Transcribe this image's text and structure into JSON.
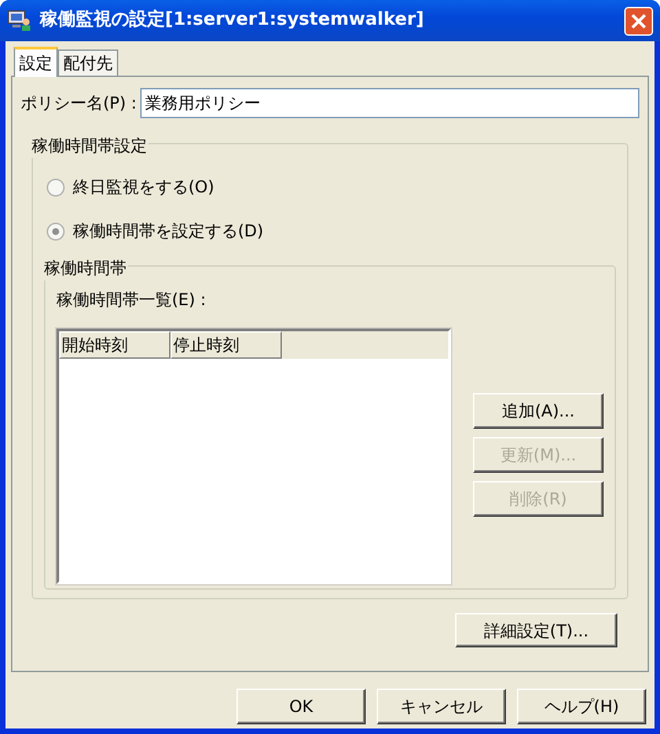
{
  "window": {
    "title": "稼働監視の設定[1:server1:systemwalker]"
  },
  "tabs": [
    {
      "label": "設定",
      "selected": true
    },
    {
      "label": "配付先",
      "selected": false
    }
  ],
  "policy_name": {
    "label": "ポリシー名(P) :",
    "value": "業務用ポリシー"
  },
  "time_settings": {
    "title": "稼働時間帯設定",
    "options": [
      {
        "label": "終日監視をする(O)",
        "selected": false
      },
      {
        "label": "稼働時間帯を設定する(D)",
        "selected": true
      }
    ],
    "time_zone": {
      "title": "稼働時間帯",
      "list_label": "稼働時間帯一覧(E) :",
      "columns": [
        "開始時刻",
        "停止時刻"
      ],
      "buttons": [
        {
          "label": "追加(A)...",
          "disabled": false
        },
        {
          "label": "更新(M)...",
          "disabled": true
        },
        {
          "label": "削除(R)",
          "disabled": true
        }
      ]
    }
  },
  "detail_button": "詳細設定(T)...",
  "buttons": [
    "OK",
    "キャンセル",
    "ヘルプ(H)"
  ]
}
